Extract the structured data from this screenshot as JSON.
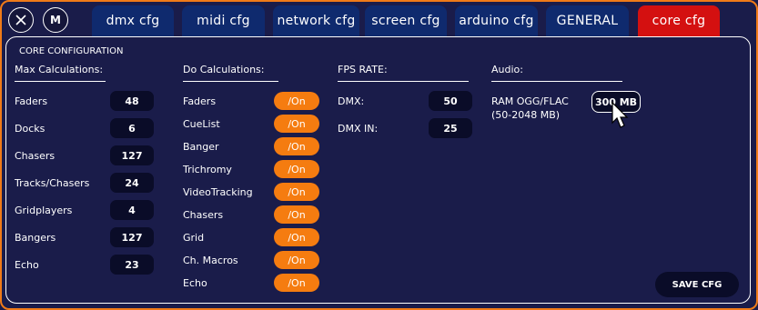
{
  "top_buttons": {
    "close_icon": "close-icon",
    "m_label": "M"
  },
  "tabs": [
    {
      "label": "dmx cfg",
      "active": false
    },
    {
      "label": "midi cfg",
      "active": false
    },
    {
      "label": "network cfg",
      "active": false
    },
    {
      "label": "screen cfg",
      "active": false
    },
    {
      "label": "arduino cfg",
      "active": false
    },
    {
      "label": "GENERAL",
      "active": false
    },
    {
      "label": "core cfg",
      "active": true
    }
  ],
  "panel_title": "CORE CONFIGURATION",
  "max_calc": {
    "header": "Max Calculations:",
    "rows": [
      {
        "label": "Faders",
        "value": "48"
      },
      {
        "label": "Docks",
        "value": "6"
      },
      {
        "label": "Chasers",
        "value": "127"
      },
      {
        "label": "Tracks/Chasers",
        "value": "24"
      },
      {
        "label": "Gridplayers",
        "value": "4"
      },
      {
        "label": "Bangers",
        "value": "127"
      },
      {
        "label": "Echo",
        "value": "23"
      }
    ]
  },
  "do_calc": {
    "header": "Do Calculations:",
    "rows": [
      {
        "label": "Faders",
        "state": "/On"
      },
      {
        "label": "CueList",
        "state": "/On"
      },
      {
        "label": "Banger",
        "state": "/On"
      },
      {
        "label": "Trichromy",
        "state": "/On"
      },
      {
        "label": "VideoTracking",
        "state": "/On"
      },
      {
        "label": "Chasers",
        "state": "/On"
      },
      {
        "label": "Grid",
        "state": "/On"
      },
      {
        "label": "Ch. Macros",
        "state": "/On"
      },
      {
        "label": "Echo",
        "state": "/On"
      }
    ]
  },
  "fps": {
    "header": "FPS RATE:",
    "rows": [
      {
        "label": "DMX:",
        "value": "50"
      },
      {
        "label": "DMX IN:",
        "value": "25"
      }
    ]
  },
  "audio": {
    "header": "Audio:",
    "ram_label_line1": "RAM OGG/FLAC",
    "ram_label_line2": "(50-2048 MB)",
    "ram_value": "300 MB"
  },
  "save_label": "SAVE CFG",
  "colors": {
    "background": "#1a1c4a",
    "accent_orange": "#f57c10",
    "tab_blue": "#0f2a6e",
    "tab_active_red": "#d41010"
  }
}
